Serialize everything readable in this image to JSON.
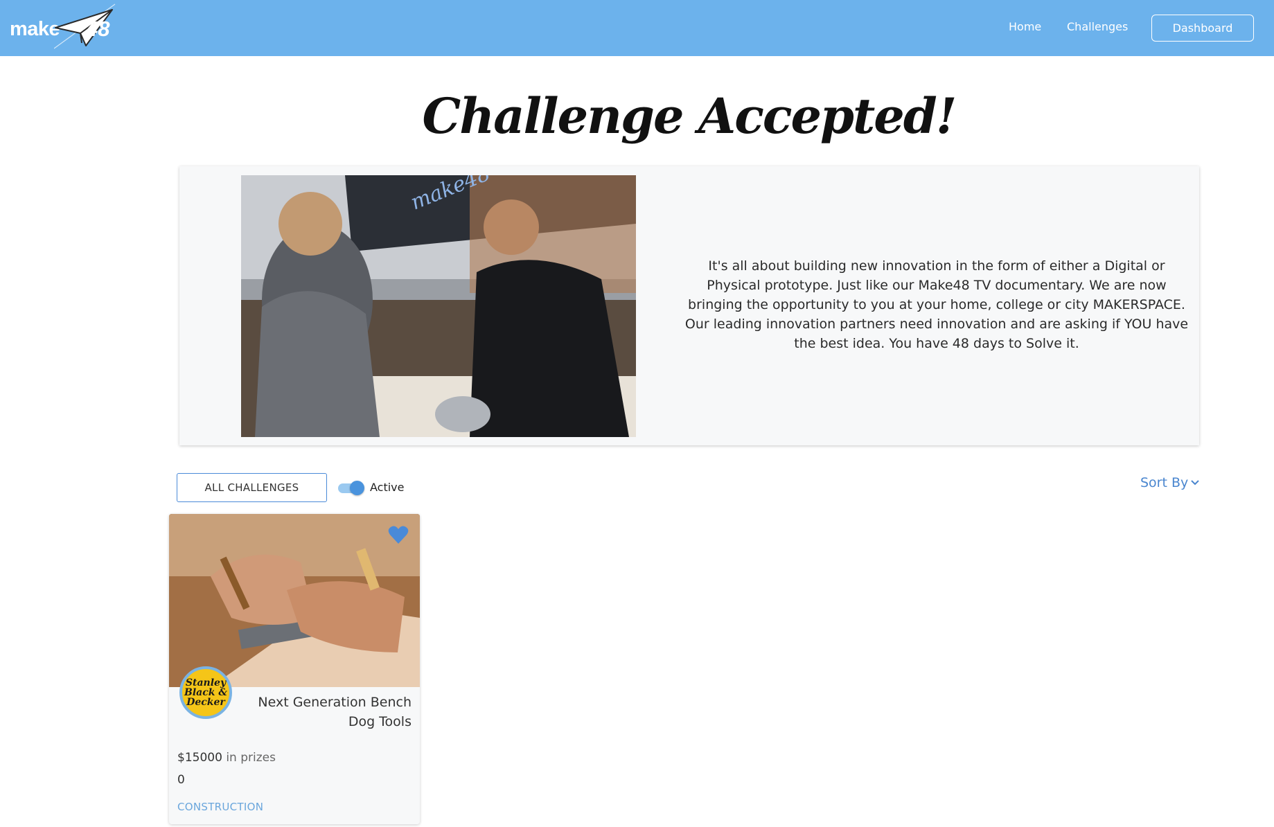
{
  "brand": {
    "make": "make",
    "number": "48"
  },
  "nav": {
    "home": "Home",
    "challenges": "Challenges",
    "dashboard": "Dashboard"
  },
  "page": {
    "title": "Challenge Accepted!"
  },
  "hero": {
    "description": "It's all about building new innovation in the form of either a Digital or Physical prototype. Just like our Make48 TV documentary. We are now bringing the opportunity to you at your home, college or city MAKERSPACE. Our leading innovation partners need innovation and are asking if YOU have the best idea. You have 48 days to Solve it."
  },
  "filters": {
    "all_label": "ALL CHALLENGES",
    "toggle_label": "Active",
    "toggle_on": true,
    "sort_label": "Sort By"
  },
  "challenges": [
    {
      "sponsor_line1": "Stanley",
      "sponsor_line2": "Black &",
      "sponsor_line3": "Decker",
      "title": "Next Generation Bench Dog Tools",
      "prize_amount": "$15000",
      "prize_suffix": "in prizes",
      "count": "0",
      "category": "CONSTRUCTION",
      "favorited": true
    }
  ],
  "colors": {
    "navbar": "#6cb2ec",
    "accent": "#4a86cf",
    "category": "#6aa6dc",
    "sponsor_badge": "#f5c518"
  }
}
